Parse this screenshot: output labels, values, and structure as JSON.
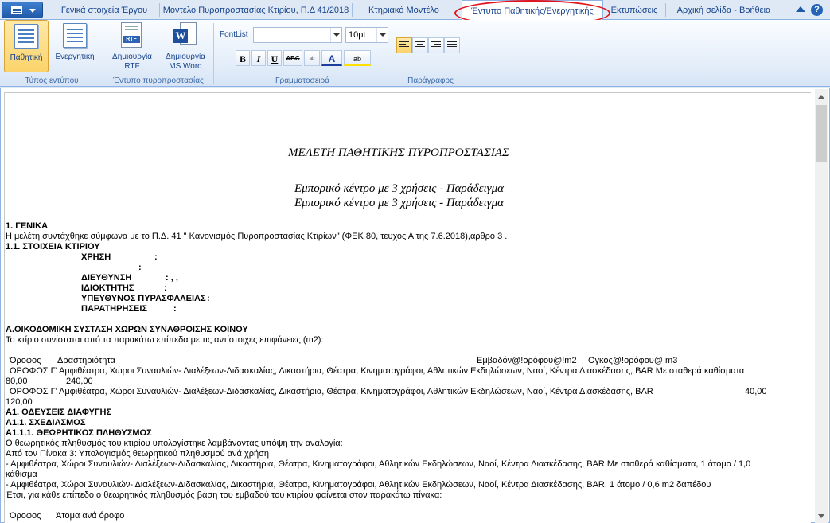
{
  "tabs": [
    {
      "label": "Γενικά στοιχεία Έργου"
    },
    {
      "label": "Μοντέλο Πυροπροστασίας Κτιρίου, Π.Δ 41/2018"
    },
    {
      "label": "Κτηριακό Μοντέλο"
    },
    {
      "label": "Έντυπο Παθητικής/Ενεργητικής"
    },
    {
      "label": "Εκτυπώσεις"
    },
    {
      "label": "Αρχική σελίδα - Βοήθεια"
    }
  ],
  "active_tab": "Έντυπο Παθητικής/Ενεργητικής",
  "help_label": "?",
  "ribbon": {
    "form_type": {
      "label": "Τύπος εντύπου",
      "passive": "Παθητική",
      "active": "Ενεργητική"
    },
    "fire_form": {
      "label": "Έντυπο πυροπροστασίας",
      "rtf_line1": "Δημιουργία",
      "rtf_line2": "RTF",
      "rtf_tag": "RTF",
      "word_line1": "Δημιουργία",
      "word_line2": "MS Word",
      "word_tag": "W"
    },
    "font": {
      "label": "Γραμματοσειρά",
      "fontlist_label": "FontList",
      "font_value": "",
      "size_value": "10pt",
      "bold": "B",
      "italic": "I",
      "underline": "U",
      "strike": "ABC",
      "color": "A",
      "highlight": "ab"
    },
    "paragraph": {
      "label": "Παράγραφος"
    }
  },
  "document": {
    "title": "ΜΕΛΕΤΗ ΠΑΘΗΤΙΚΗΣ ΠΥΡΟΠΡΟΣΤΑΣΙΑΣ",
    "subtitle1": "Εμπορικό κέντρο με 3 χρήσεις - Παράδειγμα",
    "subtitle2": "Εμπορικό κέντρο με 3 χρήσεις - Παράδειγμα",
    "lines": [
      {
        "text": "1. ΓΕΝΙΚΑ",
        "bold": true
      },
      {
        "text": "  Η μελέτη συντάχθηκε σύμφωνα με το Π.Δ. 41 \" Κανονισμός Πυροπροστασίας Κτιρίων\" (ΦΕΚ 80, τευχος Α της 7.6.2018),αρθρο 3 ."
      },
      {
        "text": "1.1. ΣΤΟΙΧΕΙΑ ΚΤΙΡΙΟΥ",
        "bold": true
      }
    ],
    "building_fields": [
      {
        "label": "ΧΡΗΣΗ",
        "value": ":"
      },
      {
        "label": "",
        "value": ":"
      },
      {
        "label": "ΔΙΕΥΘΥΝΣΗ",
        "value": ": ,  ,"
      },
      {
        "label": "ΙΔΙΟΚΤΗΤΗΣ",
        "value": ":"
      },
      {
        "label": "ΥΠΕΥΘΥΝΟΣ ΠΥΡΑΣΦΑΛΕΙΑΣ",
        "value": ":"
      },
      {
        "label": "ΠΑΡΑΤΗΡΗΣΕΙΣ",
        "value": ":"
      }
    ],
    "section_a_title": "Α.ΟΙΚΟΔΟΜΙΚΗ ΣΥΣΤΑΣΗ ΧΩΡΩΝ ΣΥΝΑΘΡΟΙΣΗΣ ΚΟΙΝΟΥ",
    "section_a_intro": "Το κτίριο συνίσταται από τα παρακάτω επίπεδα με τις αντίστοιχες επιφάνειες (m2):",
    "table_headers": {
      "floor": "Όροφος",
      "activity": "Δραστηριότητα",
      "area": "Εμβαδόν@!ορόφου@!m2",
      "volume": "Ογκος@!ορόφου@!m3"
    },
    "table_rows": [
      {
        "floor": "ΟΡΟΦΟΣ Γ'",
        "activity": "Αμφιθέατρα, Χώροι Συναυλιών- Διαλέξεων-Διδασκαλίας, Δικαστήρια, Θέατρα, Κινηματογράφοι, Αθλητικών Εκδηλώσεων, Ναοί, Κέντρα Διασκέδασης, BAR Με σταθερά καθίσματα",
        "area": "80,00",
        "volume": "240,00"
      },
      {
        "floor": "ΟΡΟΦΟΣ Γ'",
        "activity": "Αμφιθέατρα, Χώροι Συναυλιών- Διαλέξεων-Διδασκαλίας, Δικαστήρια, Θέατρα, Κινηματογράφοι, Αθλητικών Εκδηλώσεων, Ναοί, Κέντρα Διασκέδασης, BAR",
        "area": "40,00",
        "volume": "120,00"
      }
    ],
    "a1_title": "Α1. ΟΔΕΥΣΕΙΣ ΔΙΑΦΥΓΗΣ",
    "a11_title": "Α1.1. ΣΧΕΔΙΑΣΜΟΣ",
    "a111_title": "Α1.1.1. ΘΕΩΡΗΤΙΚΟΣ ΠΛΗΘΥΣΜΟΣ",
    "occ_line1": "Ο θεωρητικός πληθυσμός του κτιρίου υπολογίστηκε λαμβάνοντας υπόψη την αναλογία:",
    "occ_line2": "Από τον Πίνακα 3: Υπολογισμός θεωρητικού πληθυσμού ανά χρήση",
    "occ_line3": " - Αμφιθέατρα, Χώροι Συναυλιών- Διαλέξεων-Διδασκαλίας, Δικαστήρια, Θέατρα, Κινηματογράφοι, Αθλητικών Εκδηλώσεων, Ναοί, Κέντρα Διασκέδασης, BAR Με σταθερά καθίσματα,  1 άτομο / 1,0",
    "occ_line3b": "κάθισμα",
    "occ_line4": " - Αμφιθέατρα, Χώροι Συναυλιών- Διαλέξεων-Διδασκαλίας, Δικαστήρια, Θέατρα, Κινηματογράφοι, Αθλητικών Εκδηλώσεων, Ναοί, Κέντρα Διασκέδασης, BAR,  1 άτομο / 0,6 m2 δαπέδου",
    "occ_line5": "Έτσι, για κάθε επίπεδο ο θεωρητικός πληθυσμός βάση του εμβαδού του κτιρίου φαίνεται στον παρακάτω πίνακα:",
    "occ_header_floor": "Όροφος",
    "occ_header_persons": "Άτομα ανά όροφο"
  }
}
